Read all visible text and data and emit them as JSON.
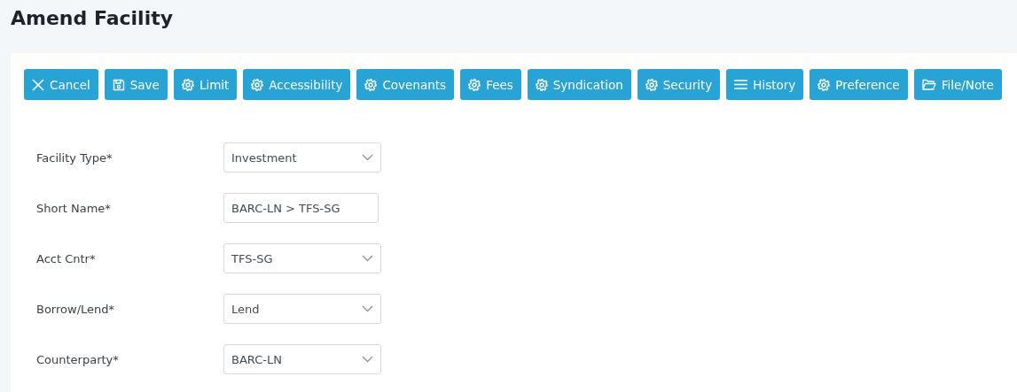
{
  "page": {
    "title": "Amend Facility"
  },
  "toolbar": [
    {
      "label": "Cancel",
      "kind": "close"
    },
    {
      "label": "Save",
      "kind": "save"
    },
    {
      "label": "Limit",
      "kind": "gear"
    },
    {
      "label": "Accessibility",
      "kind": "gear"
    },
    {
      "label": "Covenants",
      "kind": "gear"
    },
    {
      "label": "Fees",
      "kind": "gear"
    },
    {
      "label": "Syndication",
      "kind": "gear"
    },
    {
      "label": "Security",
      "kind": "gear"
    },
    {
      "label": "History",
      "kind": "menu"
    },
    {
      "label": "Preference",
      "kind": "gear"
    },
    {
      "label": "File/Note",
      "kind": "folder"
    }
  ],
  "form": [
    {
      "label": "Facility Type*",
      "kind": "select",
      "value": "Investment"
    },
    {
      "label": "Short Name*",
      "kind": "text",
      "value": "BARC-LN > TFS-SG"
    },
    {
      "label": "Acct Cntr*",
      "kind": "select",
      "value": "TFS-SG"
    },
    {
      "label": "Borrow/Lend*",
      "kind": "select",
      "value": "Lend"
    },
    {
      "label": "Counterparty*",
      "kind": "select",
      "value": "BARC-LN"
    }
  ]
}
